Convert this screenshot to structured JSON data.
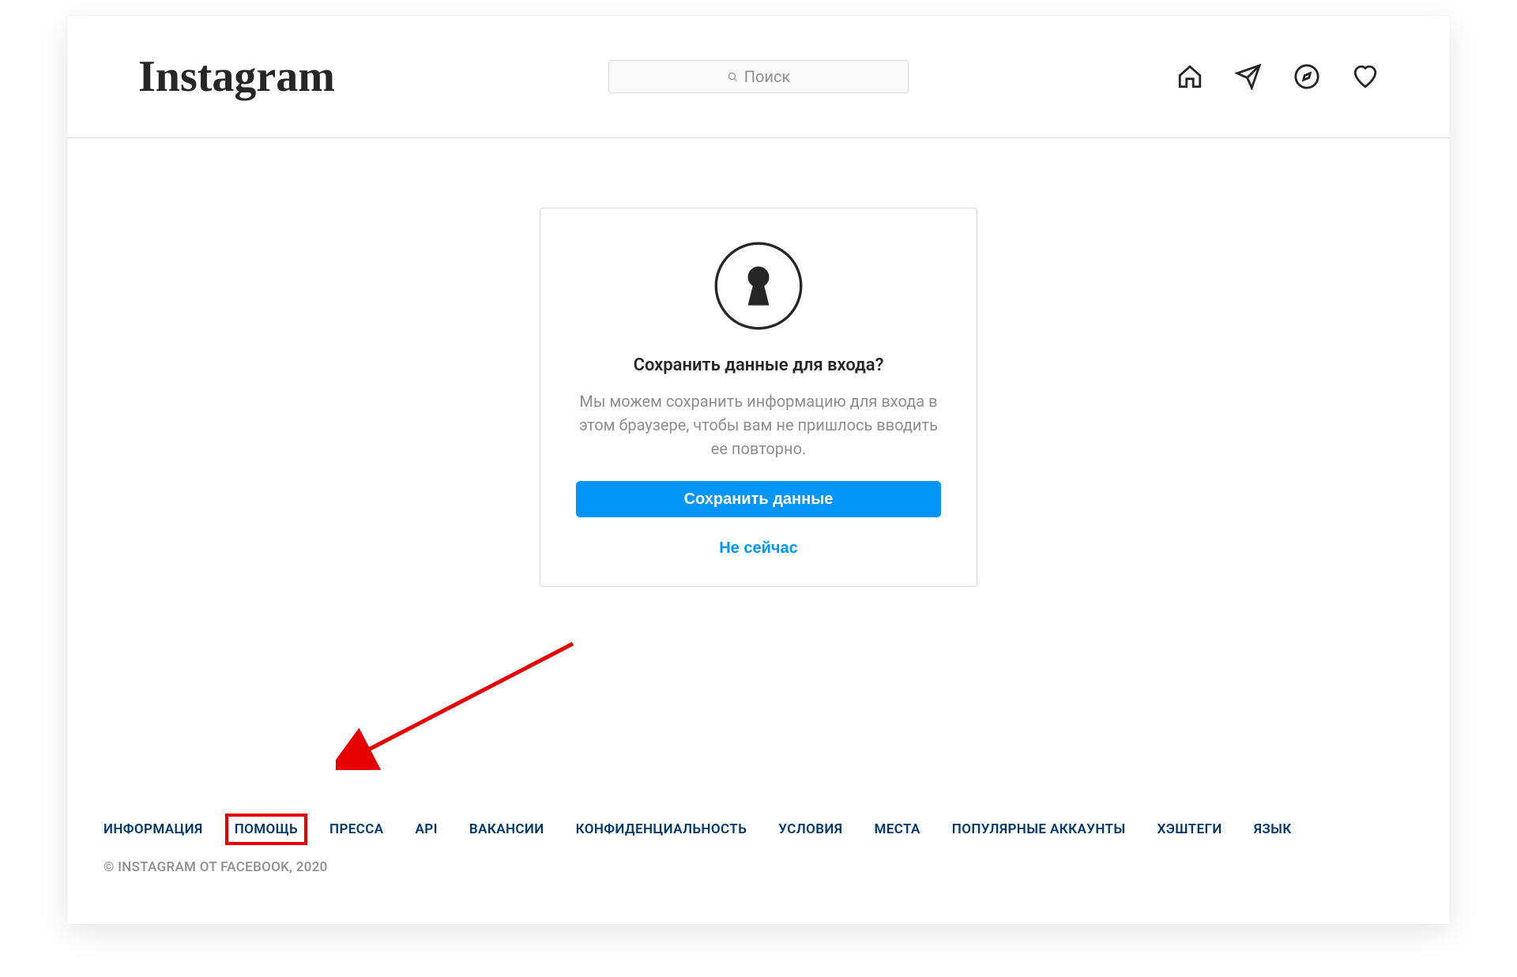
{
  "brand": {
    "logo_text": "Instagram"
  },
  "search": {
    "placeholder": "Поиск"
  },
  "dialog": {
    "title": "Сохранить данные для входа?",
    "body": "Мы можем сохранить информацию для входа в этом браузере, чтобы вам не пришлось вводить ее повторно.",
    "primary_button": "Сохранить данные",
    "secondary_button": "Не сейчас"
  },
  "footer": {
    "links": [
      "ИНФОРМАЦИЯ",
      "ПОМОЩЬ",
      "ПРЕССА",
      "API",
      "ВАКАНСИИ",
      "КОНФИДЕНЦИАЛЬНОСТЬ",
      "УСЛОВИЯ",
      "МЕСТА",
      "ПОПУЛЯРНЫЕ АККАУНТЫ",
      "ХЭШТЕГИ",
      "ЯЗЫК"
    ],
    "highlighted_index": 1,
    "copyright": "© Instagram от Facebook, 2020"
  },
  "annotation": {
    "arrow_target": "footer-link-help"
  }
}
